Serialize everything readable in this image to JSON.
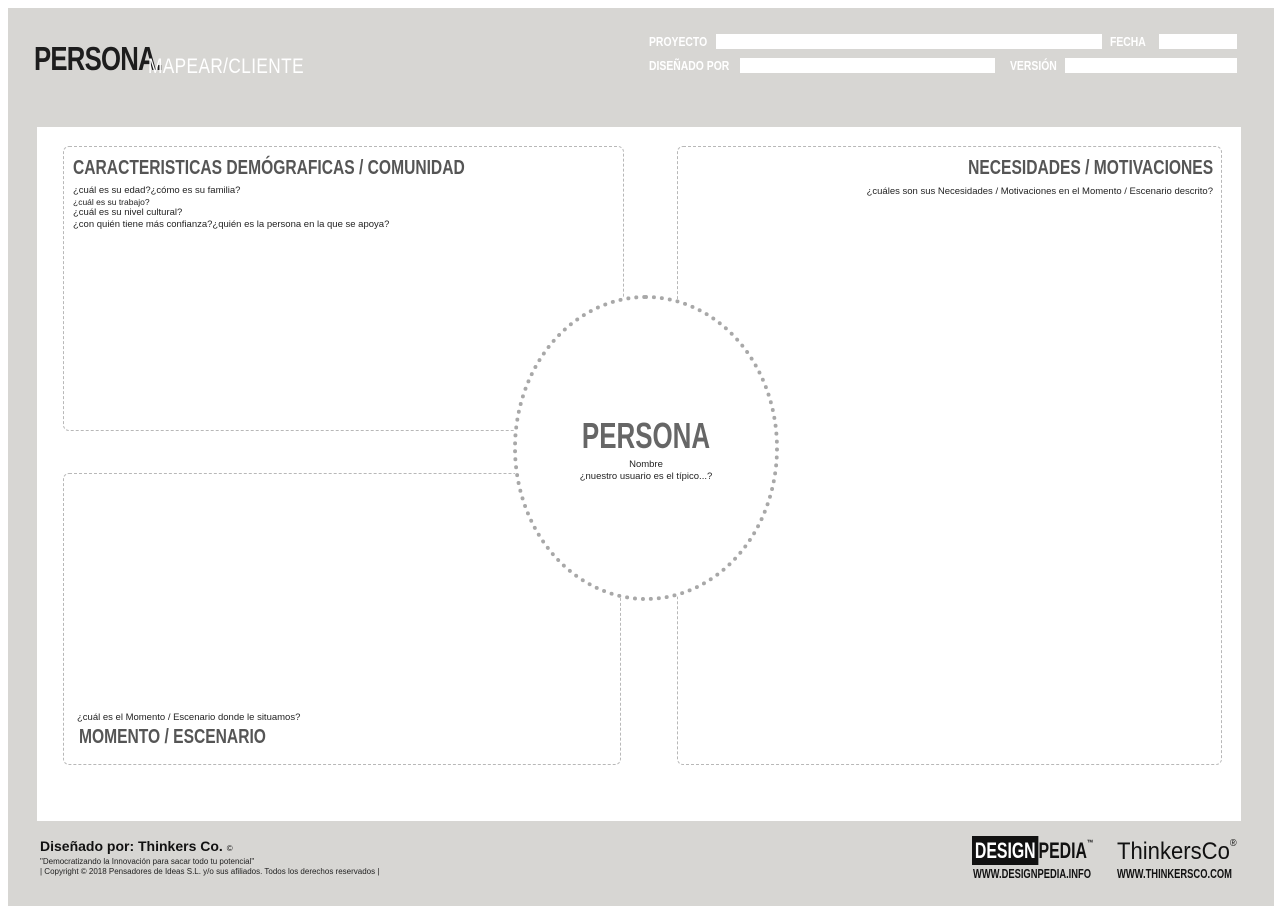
{
  "header": {
    "title": "PERSONA.",
    "subtitle": "MAPEAR/CLIENTE",
    "fields": {
      "proyecto_label": "PROYECTO",
      "fecha_label": "FECHA",
      "disenado_label": "DISEÑADO POR",
      "version_label": "VERSIÓN"
    }
  },
  "sections": {
    "demograficas": {
      "title": "CARACTERISTICAS DEMÓGRAFICAS / COMUNIDAD",
      "q1": "¿cuál es su edad?¿cómo es su familia?",
      "q2": "¿cuál es su trabajo?",
      "q3": "¿cuál es su nivel cultural?",
      "q4": "¿con quién tiene más confianza?¿quién es la persona en la que se apoya?"
    },
    "necesidades": {
      "title": "NECESIDADES / MOTIVACIONES",
      "q1": "¿cuáles son sus Necesidades / Motivaciones en el Momento / Escenario descrito?"
    },
    "momento": {
      "title": "MOMENTO / ESCENARIO",
      "q1": "¿cuál es el Momento / Escenario donde le situamos?"
    },
    "persona": {
      "title": "PERSONA",
      "name": "Nombre",
      "q1": "¿nuestro usuario es el típico...?"
    }
  },
  "footer": {
    "designed_by": "Diseñado por: Thinkers Co.",
    "designed_mark": "©",
    "tagline": "\"Democratizando la Innovación para sacar todo tu potencial\"",
    "copyright": "| Copyright © 2018 Pensadores de Ideas S.L. y/o sus afiliados. Todos los derechos reservados |",
    "brand1_boxed": "DESIGN",
    "brand1_rest": "PEDIA",
    "brand1_tm": "™",
    "brand1_url": "WWW.DESIGNPEDIA.INFO",
    "brand2": "ThinkersCo",
    "brand2_mark": "®",
    "brand2_url": "WWW.THINKERSCO.COM"
  }
}
